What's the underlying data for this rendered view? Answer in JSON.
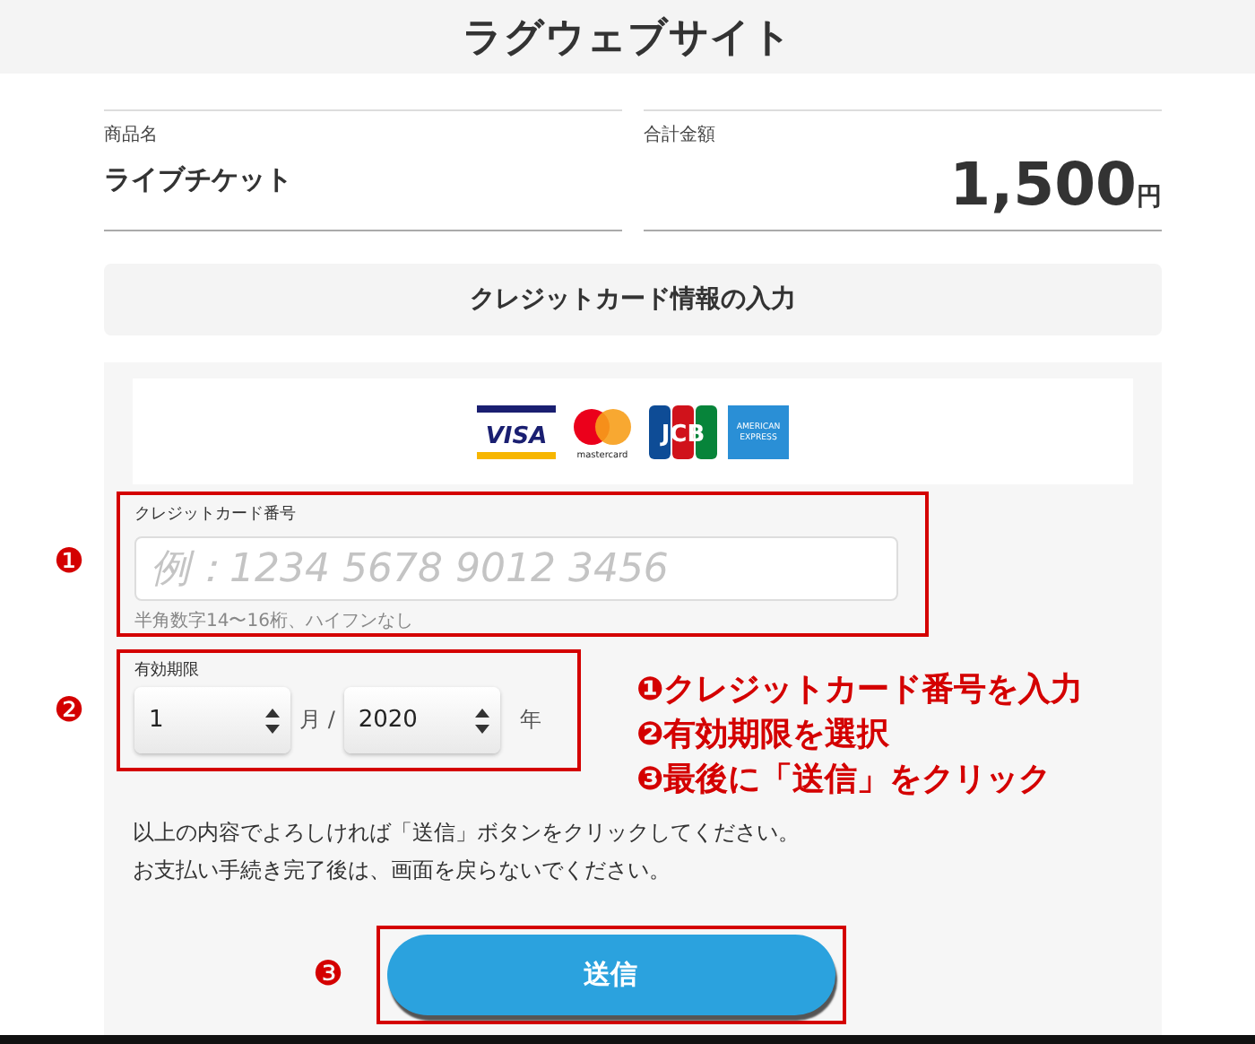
{
  "header": {
    "title": "ラグウェブサイト"
  },
  "summary": [
    {
      "label": "商品名",
      "value": "ライブチケット",
      "kind": "text"
    },
    {
      "label": "合計金額",
      "value": "1,500",
      "unit": "円",
      "kind": "price"
    }
  ],
  "section_title": "クレジットカード情報の入力",
  "card_brands": [
    {
      "kind": "visa",
      "label": "VISA"
    },
    {
      "kind": "mastercard",
      "label": "mastercard"
    },
    {
      "kind": "jcb",
      "label": "JCB"
    },
    {
      "kind": "amex",
      "lines": [
        "AMERICAN",
        "EXPRESS"
      ]
    }
  ],
  "card_number": {
    "marker": "❶",
    "label": "クレジットカード番号",
    "placeholder": "例：1234 5678 9012 3456",
    "hint": "半角数字14〜16桁、ハイフンなし"
  },
  "expiry": {
    "marker": "❷",
    "label": "有効期限",
    "month": "1",
    "month_unit": "月 /",
    "year": "2020",
    "year_unit": "年"
  },
  "instructions": [
    "❶クレジットカード番号を入力",
    "❷有効期限を選択",
    "❸最後に「送信」をクリック"
  ],
  "notice": [
    "以上の内容でよろしければ「送信」ボタンをクリックしてください。",
    "お支払い手続き完了後は、画面を戻らないでください。"
  ],
  "submit": {
    "marker": "❸",
    "label": "送信"
  }
}
